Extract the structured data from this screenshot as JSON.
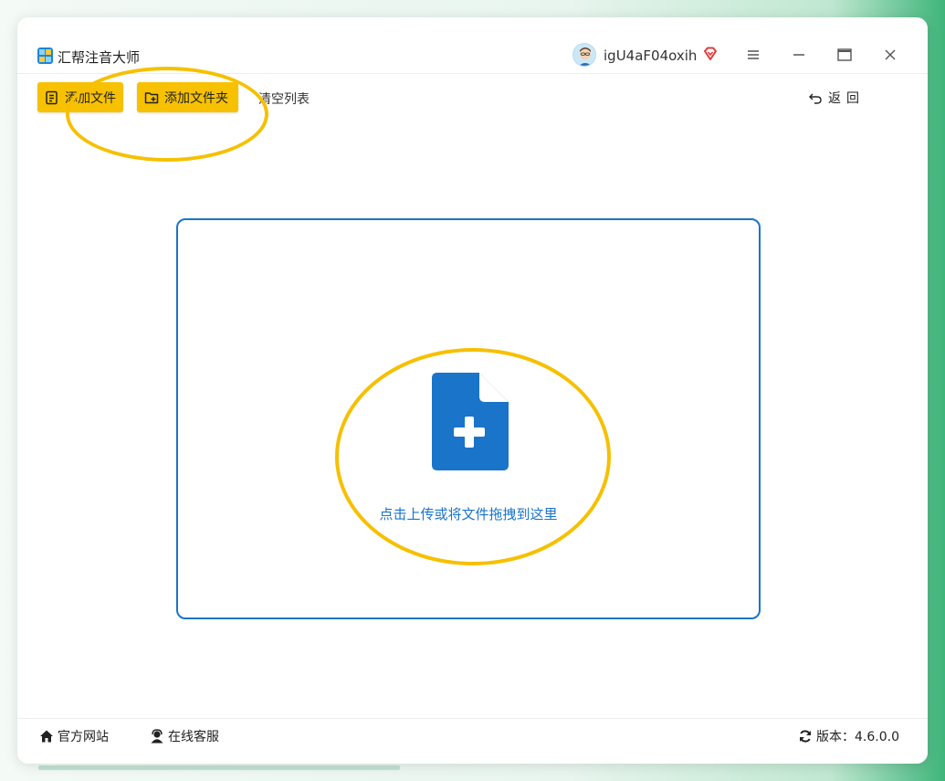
{
  "app": {
    "title": "汇帮注音大师",
    "username": "igU4aF04oxih"
  },
  "toolbar": {
    "add_file": "添加文件",
    "add_folder": "添加文件夹",
    "clear_list": "清空列表",
    "back": "返回"
  },
  "main": {
    "drop_text": "点击上传或将文件拖拽到这里"
  },
  "footer": {
    "official_site": "官方网站",
    "online_support": "在线客服",
    "version_label": "版本：4.6.0.0"
  },
  "colors": {
    "accent_blue": "#1a74c9",
    "button_yellow": "#f7c100",
    "annotation_yellow": "#f6c000",
    "vip_red": "#e23a3a"
  },
  "icons": {
    "add_file": "file-list-icon",
    "add_folder": "folder-plus-icon",
    "back": "undo-arrow-icon",
    "upload": "file-plus-icon",
    "site": "home-icon",
    "support": "support-agent-icon",
    "version": "refresh-icon",
    "vip": "diamond-icon"
  }
}
